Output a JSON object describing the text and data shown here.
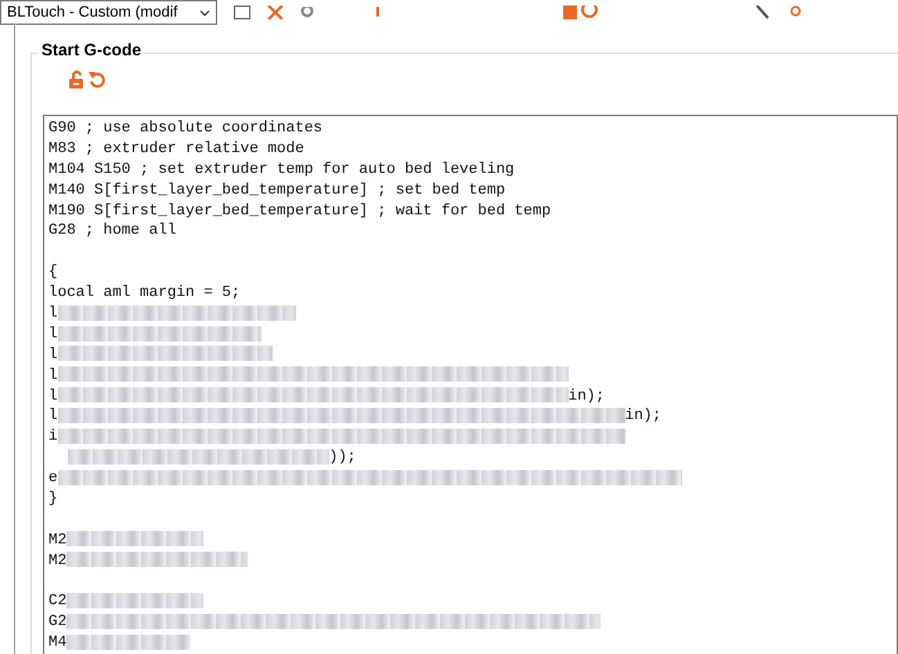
{
  "toolbar": {
    "preset_dropdown": {
      "value": "BLTouch - Custom (modif"
    }
  },
  "group": {
    "title": "Start G-code",
    "editor": {
      "lines": [
        {
          "text": "G90 ; use absolute coordinates",
          "redacted": false
        },
        {
          "text": "M83 ; extruder relative mode",
          "redacted": false
        },
        {
          "text": "M104 S150 ; set extruder temp for auto bed leveling",
          "redacted": false
        },
        {
          "text": "M140 S[first_layer_bed_temperature] ; set bed temp",
          "redacted": false
        },
        {
          "text": "M190 S[first_layer_bed_temperature] ; wait for bed temp",
          "redacted": false
        },
        {
          "text": "G28 ; home all",
          "redacted": false
        },
        {
          "redacted": false
        },
        {
          "text": "{",
          "redacted": false
        },
        {
          "text": "local aml margin = 5;",
          "redacted": false
        },
        {
          "text": "l",
          "redacted": true
        },
        {
          "text": "l",
          "redacted": true
        },
        {
          "text": "l",
          "redacted": true
        },
        {
          "text": "l",
          "redacted": true
        },
        {
          "text": "l",
          "redacted": true,
          "suffix": "in);"
        },
        {
          "text": "l",
          "redacted": true,
          "suffix": "in);"
        },
        {
          "text": "i",
          "redacted": true
        },
        {
          "redacted": true,
          "suffix": "));"
        },
        {
          "text": "e",
          "redacted": true
        },
        {
          "text": "}",
          "redacted": false
        },
        {
          "redacted": false
        },
        {
          "text": "M2",
          "redacted": true
        },
        {
          "text": "M2",
          "redacted": true
        },
        {
          "redacted": false
        },
        {
          "text": "C2",
          "redacted": true
        },
        {
          "text": "G2",
          "redacted": true
        },
        {
          "text": "M4",
          "redacted": true
        }
      ]
    }
  }
}
